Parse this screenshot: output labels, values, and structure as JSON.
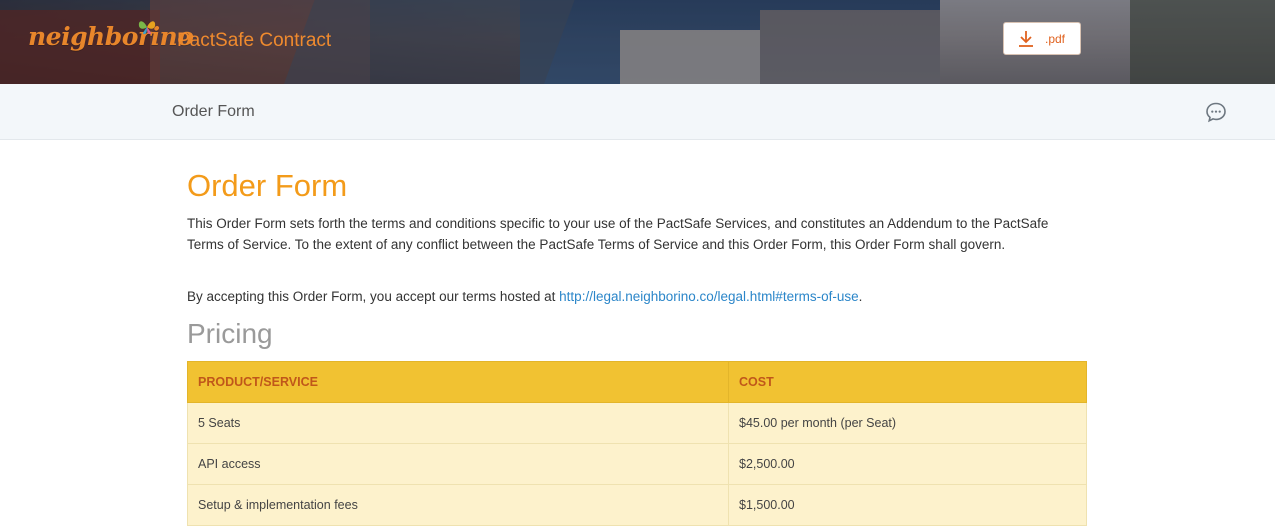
{
  "header": {
    "logo_text": "neighborino",
    "app_title": "PactSafe Contract",
    "pdf_button_label": ".pdf",
    "pdf_icon": "download-icon"
  },
  "subnav": {
    "title": "Order Form",
    "chat_icon": "chat-bubble-icon"
  },
  "document": {
    "title": "Order Form",
    "intro": "This Order Form sets forth the terms and conditions specific to your use of the PactSafe Services, and constitutes an Addendum to the PactSafe Terms of Service. To the extent of any conflict between the PactSafe Terms of Service and this Order Form, this Order Form shall govern.",
    "accept_prefix": "By accepting this Order Form, you accept our terms hosted at ",
    "accept_link": "http://legal.neighborino.co/legal.html#terms-of-use",
    "accept_suffix": "."
  },
  "pricing": {
    "heading": "Pricing",
    "columns": [
      "PRODUCT/SERVICE",
      "COST"
    ],
    "rows": [
      {
        "product": "5 Seats",
        "cost": "$45.00 per month (per Seat)"
      },
      {
        "product": "API access",
        "cost": "$2,500.00"
      },
      {
        "product": "Setup & implementation fees",
        "cost": "$1,500.00"
      }
    ]
  },
  "colors": {
    "accent_orange": "#f39b1a",
    "table_header": "#f1c232",
    "table_row": "#fdf2cc",
    "link": "#2b86c9"
  }
}
